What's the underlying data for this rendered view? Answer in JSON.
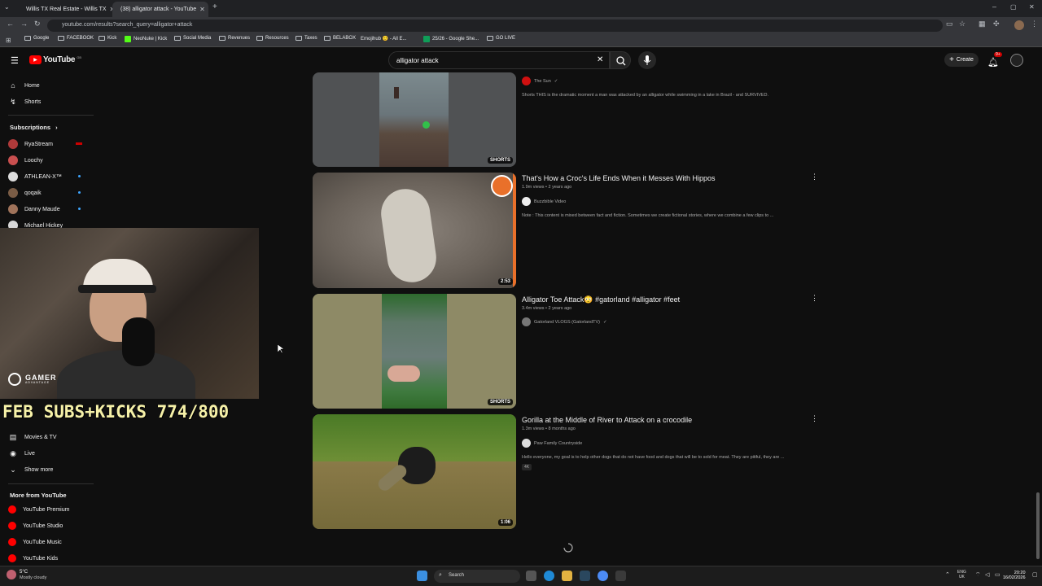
{
  "browser": {
    "tabs": [
      {
        "title": "Willis TX Real Estate - Willis TX",
        "active": false,
        "favicon_color": "#1a73e8"
      },
      {
        "title": "(38) alligator attack - YouTube",
        "active": true,
        "favicon_color": "#ff0000"
      }
    ],
    "url": "youtube.com/results?search_query=alligator+attack",
    "bookmarks": [
      "Google",
      "FACEBOOK",
      "Kick",
      "NeoNuke | Kick",
      "Social Media",
      "Revenues",
      "Resources",
      "Taxes",
      "BELABOX",
      "Emojihub 🙂 - All E...",
      "25/26 - Google She...",
      "GO LIVE"
    ]
  },
  "youtube": {
    "logo_text": "YouTube",
    "logo_region": "GB",
    "search_value": "alligator attack",
    "create_label": "Create",
    "notification_count": "9+"
  },
  "sidebar": {
    "home": "Home",
    "shorts": "Shorts",
    "subscriptions_label": "Subscriptions",
    "subscriptions": [
      {
        "name": "RyaStream",
        "color": "#b03a3a",
        "live": true
      },
      {
        "name": "Loochy",
        "color": "#c94f4f",
        "live": false
      },
      {
        "name": "ATHLEAN-X™",
        "color": "#dddddd",
        "live": false
      },
      {
        "name": "qoqaik",
        "color": "#7a5c45",
        "live": false
      },
      {
        "name": "Danny Maude",
        "color": "#a0735a",
        "live": false
      },
      {
        "name": "Michael Hickey",
        "color": "#d8d8d8",
        "live": false
      }
    ],
    "explore": [
      {
        "label": "Movies & TV",
        "icon": "clapperboard-icon"
      },
      {
        "label": "Live",
        "icon": "live-icon"
      },
      {
        "label": "Show more",
        "icon": "chevron-down-icon"
      }
    ],
    "more_from_label": "More from YouTube",
    "more_from": [
      "YouTube Premium",
      "YouTube Studio",
      "YouTube Music",
      "YouTube Kids"
    ]
  },
  "overlay": {
    "brand": "GAMER",
    "brand_sub": "ADVANTAGE",
    "subs_banner": "FEB SUBS+KICKS 774/800"
  },
  "results": [
    {
      "title": "",
      "views": "",
      "age": "",
      "channel": "The Sun",
      "verified": true,
      "description": "Shorts THIS is the dramatic moment a man was attacked by an alligator while swimming in a lake in Brazil - and SURVIVED.",
      "badge": "SHORTS"
    },
    {
      "title": "That's How a Croc's Life Ends When it Messes With Hippos",
      "views": "1.9m views",
      "age": "2 years ago",
      "channel": "Buzzbible Video",
      "verified": false,
      "description": "Note : This content is mixed between fact and fiction. Sometimes we create fictional stories, where we combine a few clips to ...",
      "badge": "2:53"
    },
    {
      "title": "Alligator Toe Attack😳 #gatorland #alligator #feet",
      "views": "3.4m views",
      "age": "2 years ago",
      "channel": "Gatorland VLOGS (GatorlandTV)",
      "verified": true,
      "description": "",
      "badge": "SHORTS"
    },
    {
      "title": "Gorilla at the Middle of River to Attack on a crocodile",
      "views": "1.3m views",
      "age": "8 months ago",
      "channel": "Paw Family Countryside",
      "verified": false,
      "description": "Hello everyone, my goal is to help other dogs that do not have food and dogs that will be to sold for meat. They are pitiful, they are ...",
      "badge": "1:06",
      "extra_badge": "4K"
    }
  ],
  "taskbar": {
    "weather_temp": "5°C",
    "weather_desc": "Mostly cloudy",
    "search_placeholder": "Search",
    "lang": "ENG",
    "region": "UK",
    "time": "20:20",
    "date": "16/02/2026"
  }
}
